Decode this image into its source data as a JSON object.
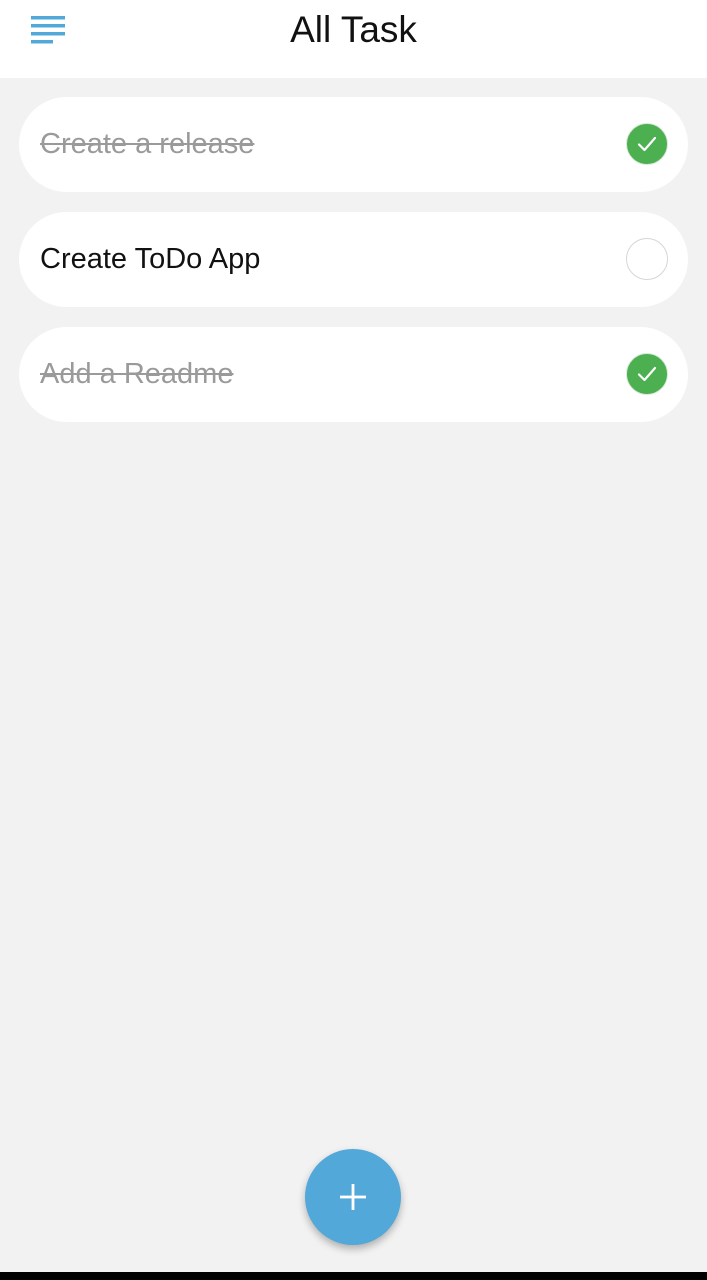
{
  "header": {
    "title": "All Task",
    "menu_icon": "menu-icon"
  },
  "tasks": [
    {
      "label": "Create a release",
      "done": true
    },
    {
      "label": "Create ToDo App",
      "done": false
    },
    {
      "label": "Add a Readme",
      "done": true
    }
  ],
  "fab": {
    "icon": "plus-icon"
  },
  "colors": {
    "accent": "#52a8d9",
    "done_green": "#4caf50",
    "background": "#f2f2f2",
    "card": "#ffffff",
    "done_text": "#9a9a9a"
  }
}
